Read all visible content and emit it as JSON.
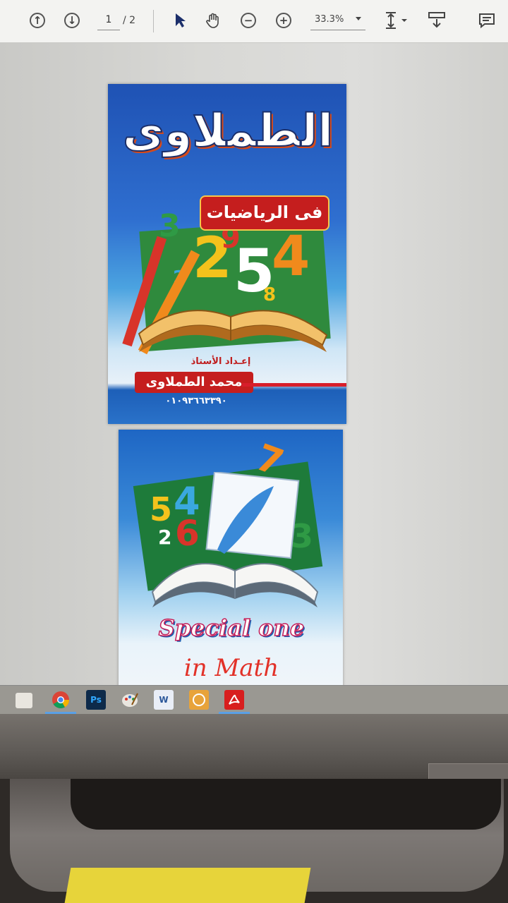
{
  "toolbar": {
    "page_current": "1",
    "page_total": "/ 2",
    "zoom": "33.3%"
  },
  "page1": {
    "title": "الطملاوى",
    "subtitle": "فى الرياضيات",
    "numbers": [
      "3",
      "2",
      "5",
      "4",
      "9",
      "8",
      "2"
    ],
    "author_label": "إعـداد الأستاذ",
    "author_name": "محمد الطملاوى",
    "phone": "٠١٠٩٣٦٦٣٣٩٠"
  },
  "page2": {
    "numbers": [
      "5",
      "4",
      "6",
      "2",
      "3",
      "7"
    ],
    "tagline": "Special one",
    "subject": "in Math"
  },
  "taskbar": {
    "items": [
      "file-manager",
      "chrome",
      "Ps",
      "paint",
      "W",
      "image-viewer",
      "acrobat"
    ],
    "ps_label": "Ps",
    "word_label": "W"
  },
  "colors": {
    "accent_red": "#c51e1e",
    "page_blue": "#1f52b4",
    "chalk_green": "#2f8a3d",
    "taskbar": "#9a9892"
  }
}
